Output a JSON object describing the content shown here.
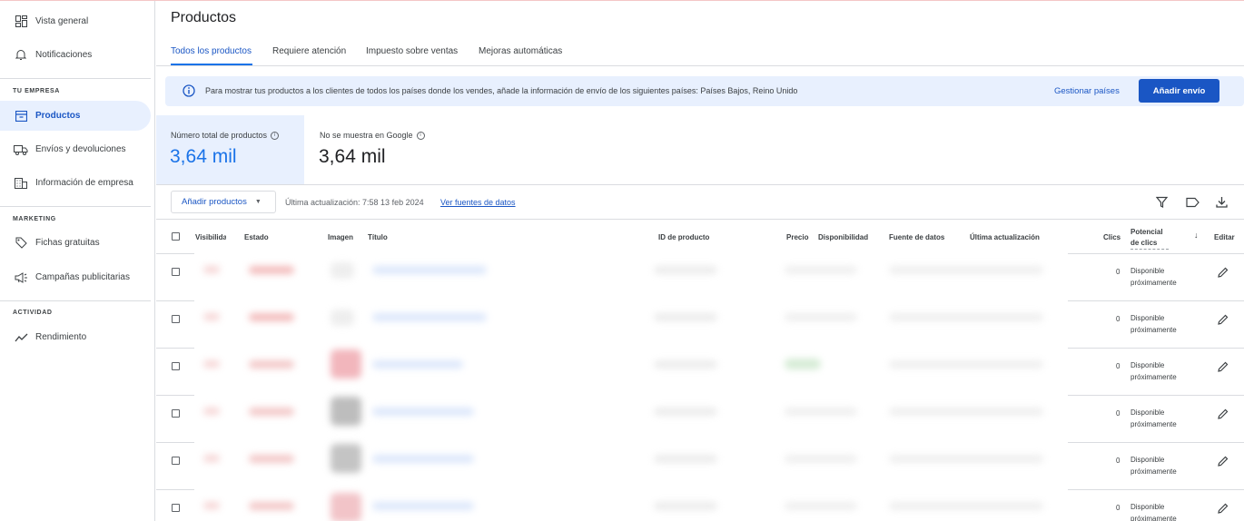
{
  "sidebar": {
    "items_top": [
      {
        "label": "Vista general",
        "icon": "dashboard-icon"
      },
      {
        "label": "Notificaciones",
        "icon": "bell-icon"
      }
    ],
    "section_business": "TU EMPRESA",
    "items_business": [
      {
        "label": "Productos",
        "icon": "product-box-icon",
        "active": true
      },
      {
        "label": "Envíos y devoluciones",
        "icon": "truck-icon"
      },
      {
        "label": "Información de empresa",
        "icon": "building-icon"
      }
    ],
    "section_marketing": "MARKETING",
    "items_marketing": [
      {
        "label": "Fichas gratuitas",
        "icon": "tag-icon"
      },
      {
        "label": "Campañas publicitarias",
        "icon": "megaphone-icon"
      }
    ],
    "section_activity": "ACTIVIDAD",
    "items_activity": [
      {
        "label": "Rendimiento",
        "icon": "trending-icon"
      }
    ]
  },
  "header": {
    "title": "Productos",
    "tabs": [
      {
        "label": "Todos los productos",
        "active": true
      },
      {
        "label": "Requiere atención"
      },
      {
        "label": "Impuesto sobre ventas"
      },
      {
        "label": "Mejoras automáticas"
      }
    ]
  },
  "banner": {
    "message": "Para mostrar tus productos a los clientes de todos los países donde los vendes, añade la información de envío de los siguientes países: Países Bajos, Reino Unido",
    "link_label": "Gestionar países",
    "button_label": "Añadir envío"
  },
  "stats": [
    {
      "label": "Número total de productos",
      "value": "3,64 mil",
      "selected": true
    },
    {
      "label": "No se muestra en Google",
      "value": "3,64 mil"
    }
  ],
  "toolbar": {
    "add_products_label": "Añadir productos",
    "last_update": "Última actualización: 7:58 13 feb 2024",
    "data_sources_link": "Ver fuentes de datos"
  },
  "table": {
    "headers": {
      "visibility": "Visibilida",
      "status": "Estado",
      "image": "Imagen",
      "title": "Título",
      "product_id": "ID de producto",
      "price": "Precio",
      "availability": "Disponibilidad",
      "data_source": "Fuente de datos",
      "last_update": "Última actualización",
      "clicks": "Clics",
      "click_potential": "Potencial de clics",
      "edit": "Editar"
    },
    "rows": [
      {
        "clicks": "0",
        "potential": "Disponible próximamente"
      },
      {
        "clicks": "0",
        "potential": "Disponible próximamente"
      },
      {
        "clicks": "0",
        "potential": "Disponible próximamente"
      },
      {
        "clicks": "0",
        "potential": "Disponible próximamente"
      },
      {
        "clicks": "0",
        "potential": "Disponible próximamente"
      },
      {
        "clicks": "0",
        "potential": "Disponible próximamente"
      }
    ]
  },
  "colors": {
    "accent": "#1a73e8",
    "primary_button": "#1a56c4",
    "selected_bg": "#e8f0fe"
  }
}
